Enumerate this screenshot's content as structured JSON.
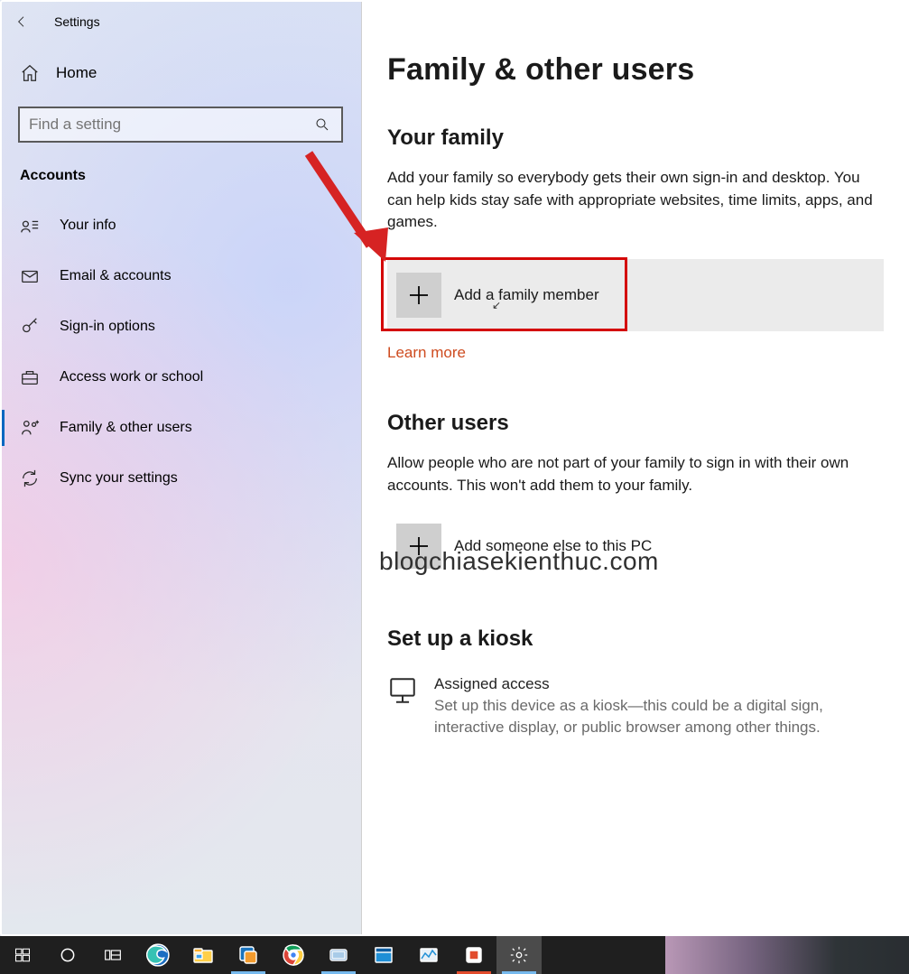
{
  "titlebar": {
    "label": "Settings"
  },
  "home": {
    "label": "Home"
  },
  "search": {
    "placeholder": "Find a setting"
  },
  "category": {
    "label": "Accounts"
  },
  "nav": [
    {
      "label": "Your info"
    },
    {
      "label": "Email & accounts"
    },
    {
      "label": "Sign-in options"
    },
    {
      "label": "Access work or school"
    },
    {
      "label": "Family & other users"
    },
    {
      "label": "Sync your settings"
    }
  ],
  "main": {
    "title": "Family & other users",
    "family": {
      "heading": "Your family",
      "desc": "Add your family so everybody gets their own sign-in and desktop. You can help kids stay safe with appropriate websites, time limits, apps, and games.",
      "add_label": "Add a family member",
      "learn_more": "Learn more"
    },
    "others": {
      "heading": "Other users",
      "desc": "Allow people who are not part of your family to sign in with their own accounts. This won't add them to your family.",
      "add_label": "Add someone else to this PC"
    },
    "kiosk": {
      "heading": "Set up a kiosk",
      "item_title": "Assigned access",
      "item_desc": "Set up this device as a kiosk—this could be a digital sign, interactive display, or public browser among other things."
    }
  },
  "watermark": "blogchiasekienthuc.com"
}
